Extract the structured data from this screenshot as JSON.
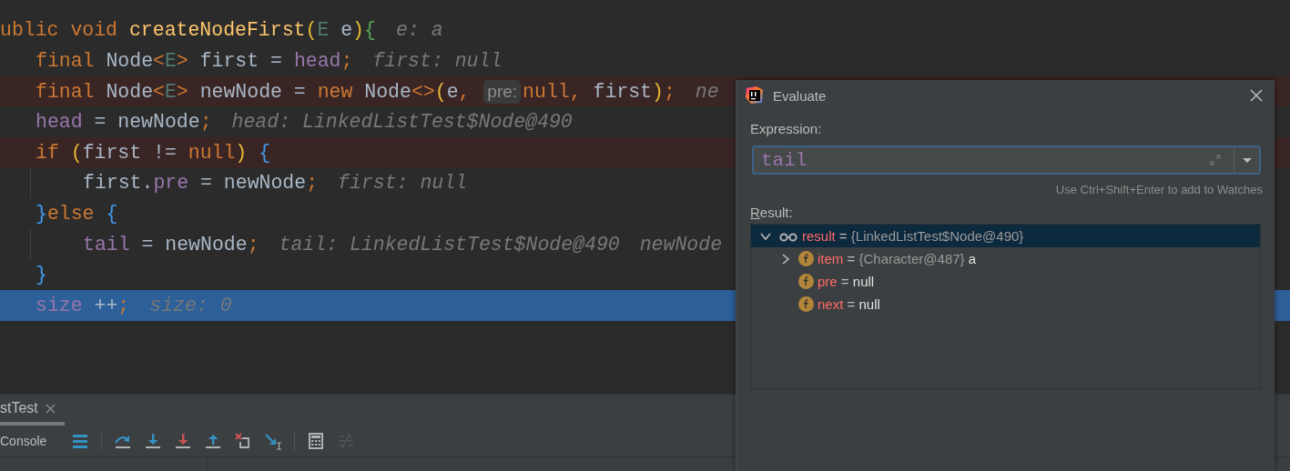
{
  "editor": {
    "lines": [
      {
        "breakpoint": false,
        "current": false,
        "segments": [
          {
            "kind": "code",
            "tokens": [
              {
                "kind": "kw",
                "text": "ublic void "
              },
              {
                "kind": "method",
                "text": "createNodeFirst"
              },
              {
                "kind": "paren",
                "text": "("
              },
              {
                "kind": "type",
                "text": "E"
              },
              {
                "kind": "plain",
                "text": " e"
              },
              {
                "kind": "paren",
                "text": ")"
              },
              {
                "kind": "brace-green",
                "text": "{"
              }
            ]
          },
          {
            "kind": "hint",
            "text": "e: a"
          }
        ],
        "children": [
          {
            "breakpoint": false,
            "current": false,
            "segments": [
              {
                "kind": "code",
                "tokens": [
                  {
                    "kind": "kw",
                    "text": "final "
                  },
                  {
                    "kind": "plain",
                    "text": "Node"
                  },
                  {
                    "kind": "kw",
                    "text": "<"
                  },
                  {
                    "kind": "type",
                    "text": "E"
                  },
                  {
                    "kind": "kw",
                    "text": ">"
                  },
                  {
                    "kind": "plain",
                    "text": " first = "
                  },
                  {
                    "kind": "field",
                    "text": "head"
                  },
                  {
                    "kind": "kw",
                    "text": ";"
                  }
                ]
              },
              {
                "kind": "hint",
                "text": "first: null"
              }
            ]
          },
          {
            "breakpoint": true,
            "current": false,
            "segments": [
              {
                "kind": "code",
                "tokens": [
                  {
                    "kind": "kw",
                    "text": "final "
                  },
                  {
                    "kind": "plain",
                    "text": "Node"
                  },
                  {
                    "kind": "kw",
                    "text": "<"
                  },
                  {
                    "kind": "type",
                    "text": "E"
                  },
                  {
                    "kind": "kw",
                    "text": ">"
                  },
                  {
                    "kind": "plain",
                    "text": " newNode = "
                  },
                  {
                    "kind": "kw",
                    "text": "new "
                  },
                  {
                    "kind": "plain",
                    "text": "Node"
                  },
                  {
                    "kind": "kw",
                    "text": "<>"
                  },
                  {
                    "kind": "paren",
                    "text": "("
                  },
                  {
                    "kind": "plain",
                    "text": "e"
                  },
                  {
                    "kind": "kw",
                    "text": ", "
                  }
                ]
              },
              {
                "kind": "chip",
                "text": "pre:"
              },
              {
                "kind": "code",
                "tokens": [
                  {
                    "kind": "kw",
                    "text": "null, "
                  },
                  {
                    "kind": "plain",
                    "text": "first"
                  },
                  {
                    "kind": "paren",
                    "text": ")"
                  },
                  {
                    "kind": "kw",
                    "text": ";"
                  }
                ]
              },
              {
                "kind": "hint",
                "text": "ne"
              }
            ]
          },
          {
            "breakpoint": false,
            "current": false,
            "segments": [
              {
                "kind": "code",
                "tokens": [
                  {
                    "kind": "field",
                    "text": "head"
                  },
                  {
                    "kind": "plain",
                    "text": " = newNode"
                  },
                  {
                    "kind": "kw",
                    "text": ";"
                  }
                ]
              },
              {
                "kind": "hint",
                "text": "head: LinkedListTest$Node@490"
              }
            ]
          },
          {
            "breakpoint": true,
            "current": false,
            "segments": [
              {
                "kind": "code",
                "tokens": [
                  {
                    "kind": "kw",
                    "text": "if "
                  },
                  {
                    "kind": "paren",
                    "text": "("
                  },
                  {
                    "kind": "plain",
                    "text": "first != "
                  },
                  {
                    "kind": "kw",
                    "text": "null"
                  },
                  {
                    "kind": "paren",
                    "text": ")"
                  },
                  {
                    "kind": "brace-blue",
                    "text": " {"
                  }
                ]
              }
            ],
            "children": [
              {
                "breakpoint": false,
                "current": false,
                "segments": [
                  {
                    "kind": "code",
                    "tokens": [
                      {
                        "kind": "plain",
                        "text": "first."
                      },
                      {
                        "kind": "field",
                        "text": "pre"
                      },
                      {
                        "kind": "plain",
                        "text": " = newNode"
                      },
                      {
                        "kind": "kw",
                        "text": ";"
                      }
                    ]
                  },
                  {
                    "kind": "hint",
                    "text": "first: null"
                  }
                ]
              }
            ]
          },
          {
            "breakpoint": false,
            "current": false,
            "segments": [
              {
                "kind": "code",
                "tokens": [
                  {
                    "kind": "brace-blue",
                    "text": "}"
                  },
                  {
                    "kind": "kw",
                    "text": "else "
                  },
                  {
                    "kind": "brace-blue",
                    "text": "{"
                  }
                ]
              }
            ],
            "children": [
              {
                "breakpoint": false,
                "current": false,
                "segments": [
                  {
                    "kind": "code",
                    "tokens": [
                      {
                        "kind": "field",
                        "text": "tail"
                      },
                      {
                        "kind": "plain",
                        "text": " = newNode"
                      },
                      {
                        "kind": "kw",
                        "text": ";"
                      }
                    ]
                  },
                  {
                    "kind": "hint",
                    "text": "tail: LinkedListTest$Node@490"
                  },
                  {
                    "kind": "hint",
                    "text": "newNode"
                  }
                ]
              }
            ]
          },
          {
            "breakpoint": false,
            "current": false,
            "segments": [
              {
                "kind": "code",
                "tokens": [
                  {
                    "kind": "brace-blue",
                    "text": "}"
                  }
                ]
              }
            ]
          },
          {
            "breakpoint": false,
            "current": true,
            "segments": [
              {
                "kind": "code",
                "tokens": [
                  {
                    "kind": "field",
                    "text": "size"
                  },
                  {
                    "kind": "plain",
                    "text": " ++"
                  },
                  {
                    "kind": "kw",
                    "text": ";"
                  }
                ]
              },
              {
                "kind": "hint",
                "text": "size: 0"
              }
            ]
          }
        ]
      }
    ]
  },
  "debug_panel": {
    "tabs": [
      {
        "label": "stTest",
        "selected": true
      }
    ],
    "toolbar": [
      {
        "kind": "label",
        "text": "Console"
      },
      {
        "kind": "layout"
      },
      {
        "kind": "separator"
      },
      {
        "kind": "step-over"
      },
      {
        "kind": "step-into"
      },
      {
        "kind": "force-step-into"
      },
      {
        "kind": "step-out"
      },
      {
        "kind": "drop-frame"
      },
      {
        "kind": "run-to-cursor"
      },
      {
        "kind": "separator"
      },
      {
        "kind": "evaluate"
      },
      {
        "kind": "trace",
        "disabled": true
      }
    ]
  },
  "dialog": {
    "title": "Evaluate",
    "expression_label": "Expression:",
    "expression": {
      "value": "tail"
    },
    "hint": "Use Ctrl+Shift+Enter to add to Watches",
    "result_label": "Result:",
    "tree": [
      {
        "kind": "watch",
        "name": "result",
        "eq": "=",
        "type": "{LinkedListTest$Node@490}",
        "expanded": true,
        "selected": true,
        "children": [
          {
            "kind": "field",
            "name": "item",
            "eq": "=",
            "type": "{Character@487}",
            "value": "a",
            "expanded": false,
            "selected": false
          },
          {
            "kind": "field",
            "name": "pre",
            "eq": "=",
            "value": "null",
            "selected": false
          },
          {
            "kind": "field",
            "name": "next",
            "eq": "=",
            "value": "null",
            "selected": false
          }
        ]
      }
    ]
  }
}
